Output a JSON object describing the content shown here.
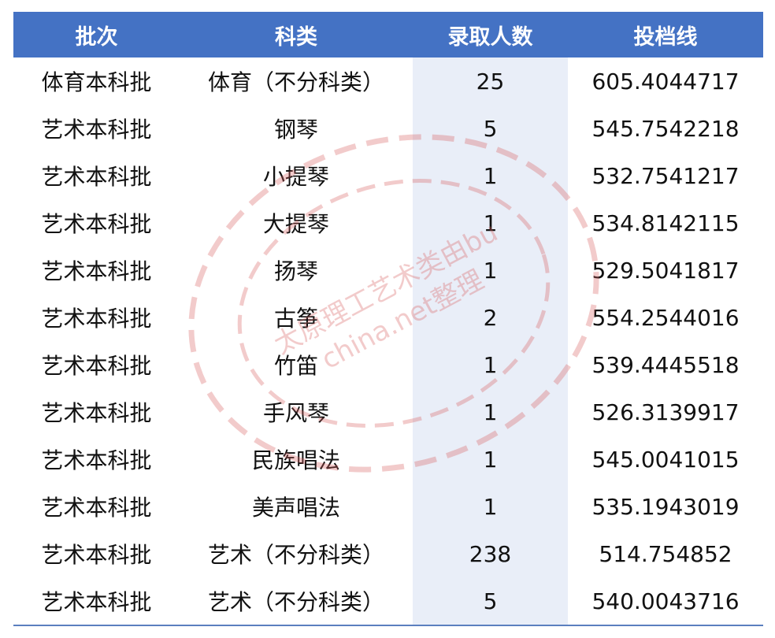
{
  "table": {
    "headers": [
      "批次",
      "科类",
      "录取人数",
      "投档线"
    ],
    "rows": [
      [
        "体育本科批",
        "体育（不分科类）",
        "25",
        "605.4044717"
      ],
      [
        "艺术本科批",
        "钢琴",
        "5",
        "545.7542218"
      ],
      [
        "艺术本科批",
        "小提琴",
        "1",
        "532.7541217"
      ],
      [
        "艺术本科批",
        "大提琴",
        "1",
        "534.8142115"
      ],
      [
        "艺术本科批",
        "扬琴",
        "1",
        "529.5041817"
      ],
      [
        "艺术本科批",
        "古筝",
        "2",
        "554.2544016"
      ],
      [
        "艺术本科批",
        "竹笛",
        "1",
        "539.4445518"
      ],
      [
        "艺术本科批",
        "手风琴",
        "1",
        "526.3139917"
      ],
      [
        "艺术本科批",
        "民族唱法",
        "1",
        "545.0041015"
      ],
      [
        "艺术本科批",
        "美声唱法",
        "1",
        "535.1943019"
      ],
      [
        "艺术本科批",
        "艺术（不分科类）",
        "238",
        "514.754852"
      ],
      [
        "艺术本科批",
        "艺术（不分科类）",
        "5",
        "540.0043716"
      ]
    ]
  },
  "watermark": {
    "line1": "太原理工艺术类由bu",
    "line2": "china.net整理"
  },
  "colors": {
    "header_bg": "#4472c4",
    "header_text": "#ffffff",
    "shade": "#e9eef8",
    "watermark": "#e8a0a0"
  }
}
